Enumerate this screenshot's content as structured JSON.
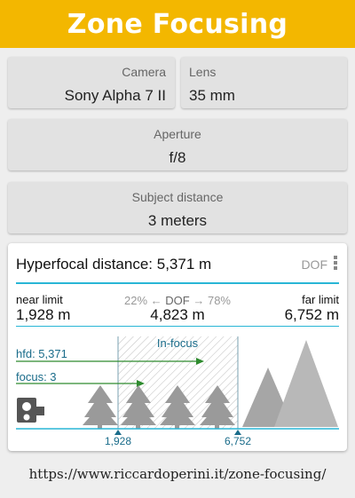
{
  "title": "Zone Focusing",
  "camera": {
    "label": "Camera",
    "value": "Sony Alpha 7 II"
  },
  "lens": {
    "label": "Lens",
    "value": "35 mm"
  },
  "aperture": {
    "label": "Aperture",
    "value": "f/8"
  },
  "subject": {
    "label": "Subject distance",
    "value": "3 meters"
  },
  "result": {
    "hyperfocal_text": "Hyperfocal distance: 5,371 m",
    "dof_link": "DOF",
    "near_label": "near limit",
    "near_value": "1,928 m",
    "far_label": "far limit",
    "far_value": "6,752 m",
    "pct_near": "22%",
    "pct_dof": "DOF",
    "pct_far": "78%",
    "dof_value": "4,823 m"
  },
  "diagram": {
    "infocus_label": "In-focus",
    "hfd_label": "hfd: 5,371",
    "focus_label": "focus: 3",
    "near_tick": "1,928",
    "far_tick": "6,752",
    "icons": [
      "camera-icon",
      "tree-icon",
      "mountain-icon"
    ],
    "colors": {
      "accent": "#29b6d6",
      "arrows": "#2e8b2e",
      "labels": "#1a6c8a",
      "trees": "#9a9a9a"
    }
  },
  "footer": "https://www.riccardoperini.it/zone-focusing/"
}
